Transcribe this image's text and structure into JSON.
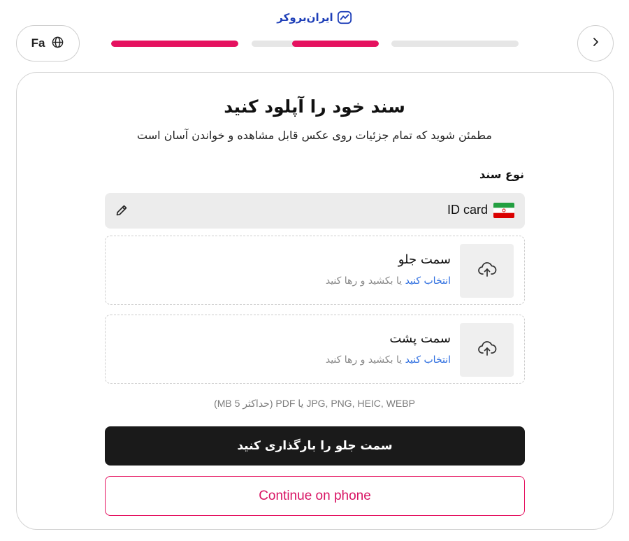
{
  "header": {
    "logo_text": "ایران‌بروکر",
    "language_label": "Fa",
    "progress": [
      1.0,
      0.68,
      0.0
    ]
  },
  "card": {
    "title": "سند خود را آپلود کنید",
    "subtitle": "مطمئن شوید که تمام جزئیات روی عکس قابل مشاهده و خواندن آسان است",
    "doc_type": {
      "label": "نوع سند",
      "value": "ID card"
    },
    "front": {
      "title": "سمت جلو",
      "select_link": "انتخاب کنید",
      "hint_rest": " یا بکشید و رها کنید"
    },
    "back": {
      "title": "سمت پشت",
      "select_link": "انتخاب کنید",
      "hint_rest": " یا بکشید و رها کنید"
    },
    "formats": "JPG, PNG, HEIC, WEBP یا PDF (حداکثر 5 MB)",
    "primary_button": "سمت جلو را بارگذاری کنید",
    "secondary_button": "Continue on phone"
  },
  "colors": {
    "accent": "#e5115f",
    "link": "#2f6fe0",
    "logo": "#1e3fb8",
    "primary_button_bg": "#1a1a1a"
  },
  "icons": [
    "globe-icon",
    "chevron-right-icon",
    "pencil-icon",
    "iran-flag-icon",
    "cloud-upload-icon"
  ]
}
